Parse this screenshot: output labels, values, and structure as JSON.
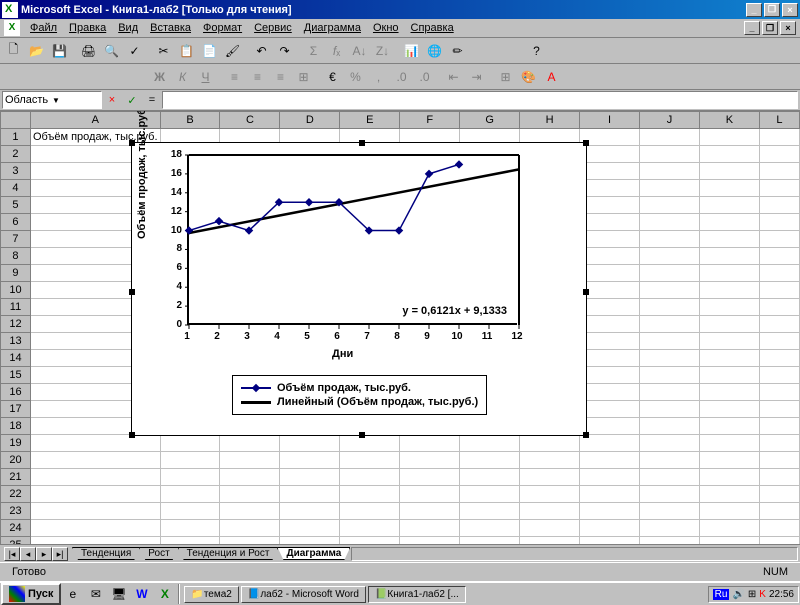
{
  "title": "Microsoft Excel - Книга1-лаб2  [Только для чтения]",
  "menu": [
    "Файл",
    "Правка",
    "Вид",
    "Вставка",
    "Формат",
    "Сервис",
    "Диаграмма",
    "Окно",
    "Справка"
  ],
  "namebox": "Область пост...",
  "cols": [
    "A",
    "B",
    "C",
    "D",
    "E",
    "F",
    "G",
    "H",
    "I",
    "J",
    "K",
    "L"
  ],
  "header_cell": "Объём продаж, тыс.руб.",
  "rows_data": [
    "10",
    "11",
    "10",
    "13",
    "13",
    "13",
    "10",
    "10",
    "16",
    "17"
  ],
  "sheets": [
    "Тенденция",
    "Рост",
    "Тенденция и Рост",
    "Диаграмма"
  ],
  "active_sheet": 3,
  "status": {
    "ready": "Готово",
    "num": "NUM"
  },
  "taskbar": {
    "start": "Пуск",
    "items": [
      "тема2",
      "лаб2 - Microsoft Word",
      "Книга1-лаб2  [..."
    ],
    "lang": "Ru",
    "time": "22:56"
  },
  "chart_data": {
    "type": "line",
    "title": "",
    "xlabel": "Дни",
    "ylabel": "Объём продаж, тыс.руб.",
    "x": [
      1,
      2,
      3,
      4,
      5,
      6,
      7,
      8,
      9,
      10
    ],
    "y": [
      10,
      11,
      10,
      13,
      13,
      13,
      10,
      10,
      16,
      17
    ],
    "xlim": [
      1,
      12
    ],
    "ylim": [
      0,
      18
    ],
    "yticks": [
      0,
      2,
      4,
      6,
      8,
      10,
      12,
      14,
      16,
      18
    ],
    "xticks": [
      1,
      2,
      3,
      4,
      5,
      6,
      7,
      8,
      9,
      10,
      11,
      12
    ],
    "trendline": {
      "slope": 0.6121,
      "intercept": 9.1333,
      "equation": "y = 0,6121x + 9,1333"
    },
    "legend": [
      "Объём продаж, тыс.руб.",
      "Линейный (Объём продаж, тыс.руб.)"
    ]
  }
}
